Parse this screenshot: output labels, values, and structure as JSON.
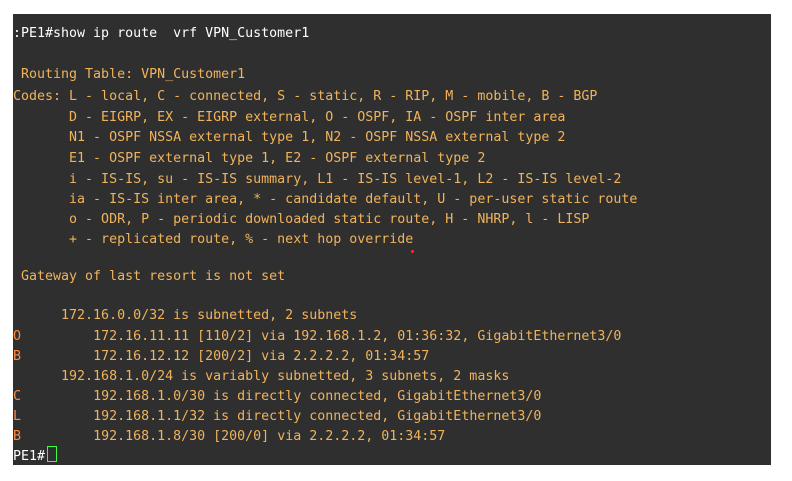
{
  "terminal": {
    "command": ":PE1#show ip route  vrf VPN_Customer1",
    "routing_table_title": " Routing Table: VPN_Customer1",
    "codes": [
      "Codes: L - local, C - connected, S - static, R - RIP, M - mobile, B - BGP",
      "       D - EIGRP, EX - EIGRP external, O - OSPF, IA - OSPF inter area",
      "       N1 - OSPF NSSA external type 1, N2 - OSPF NSSA external type 2",
      "       E1 - OSPF external type 1, E2 - OSPF external type 2",
      "       i - IS-IS, su - IS-IS summary, L1 - IS-IS level-1, L2 - IS-IS level-2",
      "       ia - IS-IS inter area, * - candidate default, U - per-user static route",
      "       o - ODR, P - periodic downloaded static route, H - NHRP, l - LISP",
      "       + - replicated route, % - next hop override"
    ],
    "gateway": " Gateway of last resort is not set",
    "routes": [
      {
        "code": "",
        "text": "      172.16.0.0/32 is subnetted, 2 subnets"
      },
      {
        "code": "O",
        "text": "         172.16.11.11 [110/2] via 192.168.1.2, 01:36:32, GigabitEthernet3/0"
      },
      {
        "code": "B",
        "text": "         172.16.12.12 [200/2] via 2.2.2.2, 01:34:57"
      },
      {
        "code": "",
        "text": "      192.168.1.0/24 is variably subnetted, 3 subnets, 2 masks"
      },
      {
        "code": "C",
        "text": "         192.168.1.0/30 is directly connected, GigabitEthernet3/0"
      },
      {
        "code": "L",
        "text": "         192.168.1.1/32 is directly connected, GigabitEthernet3/0"
      },
      {
        "code": "B",
        "text": "         192.168.1.8/30 [200/0] via 2.2.2.2, 01:34:57"
      }
    ],
    "final_prompt": "PE1#"
  }
}
